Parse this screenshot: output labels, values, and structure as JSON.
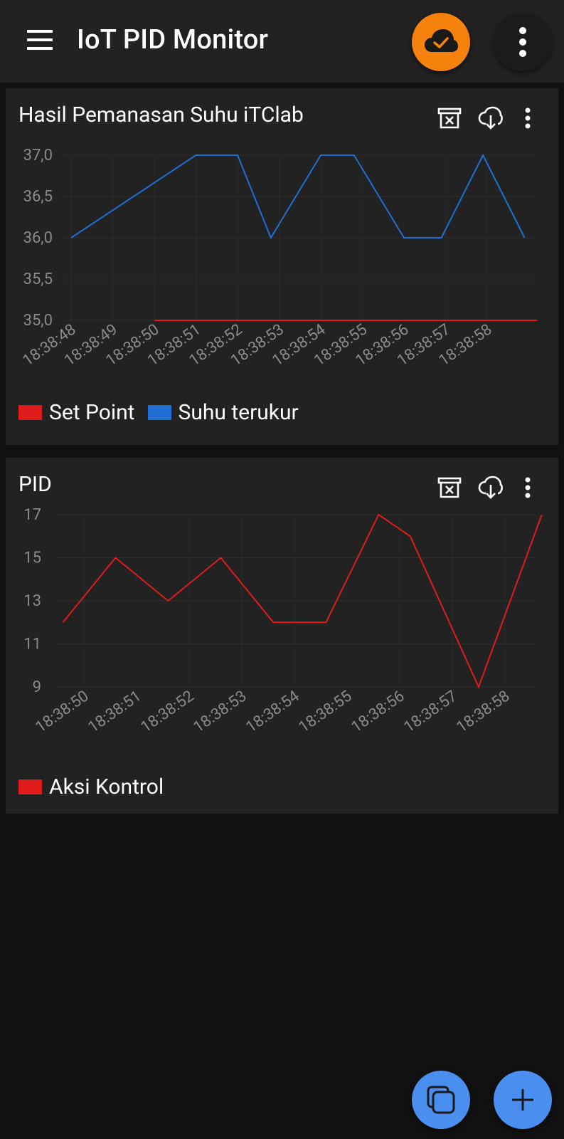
{
  "app": {
    "title": "IoT PID Monitor"
  },
  "colors": {
    "background": "#111111",
    "card": "#222222",
    "accent_orange": "#f5820d",
    "fab_blue": "#4a8ef0",
    "setpoint_red": "#e01b1b",
    "temp_blue": "#1f6fd4"
  },
  "cards": [
    {
      "title": "Hasil Pemanasan Suhu iTClab",
      "legend": [
        {
          "label": "Set Point",
          "color": "#e01b1b"
        },
        {
          "label": "Suhu terukur",
          "color": "#1f6fd4"
        }
      ]
    },
    {
      "title": "PID",
      "legend": [
        {
          "label": "Aksi Kontrol",
          "color": "#e01b1b"
        }
      ]
    }
  ],
  "chart_data": [
    {
      "type": "line",
      "title": "Hasil Pemanasan Suhu iTClab",
      "ylim": [
        35.0,
        37.0
      ],
      "yticks": [
        "37,0",
        "36,5",
        "36,0",
        "35,5",
        "35,0"
      ],
      "categories": [
        "18:38:48",
        "18:38:49",
        "18:38:50",
        "18:38:51",
        "18:38:52",
        "18:38:53",
        "18:38:54",
        "18:38:55",
        "18:38:56",
        "18:38:57",
        "18:38:58"
      ],
      "series": [
        {
          "name": "Suhu terukur",
          "color": "#1f6fd4",
          "points": [
            [
              0,
              36.0
            ],
            [
              3,
              37.0
            ],
            [
              4,
              37.0
            ],
            [
              4.8,
              36.0
            ],
            [
              6,
              37.0
            ],
            [
              6.8,
              37.0
            ],
            [
              8,
              36.0
            ],
            [
              8.9,
              36.0
            ],
            [
              9.9,
              37.0
            ],
            [
              10.9,
              36.0
            ]
          ]
        },
        {
          "name": "Set Point",
          "color": "#e01b1b",
          "points": [
            [
              2,
              35.0
            ],
            [
              11.2,
              35.0
            ]
          ]
        }
      ],
      "grid": true,
      "legend": "bottom-left"
    },
    {
      "type": "line",
      "title": "PID",
      "ylim": [
        9,
        17
      ],
      "yticks": [
        "17",
        "15",
        "13",
        "11",
        "9"
      ],
      "categories": [
        "18:38:50",
        "18:38:51",
        "18:38:52",
        "18:38:53",
        "18:38:54",
        "18:38:55",
        "18:38:56",
        "18:38:57",
        "18:38:58"
      ],
      "series": [
        {
          "name": "Aksi Kontrol",
          "color": "#e01b1b",
          "points": [
            [
              -0.4,
              12
            ],
            [
              0.6,
              15
            ],
            [
              1.6,
              13
            ],
            [
              2.6,
              15
            ],
            [
              3.6,
              12
            ],
            [
              4.6,
              12
            ],
            [
              5.6,
              17
            ],
            [
              6.2,
              16
            ],
            [
              7.5,
              9
            ],
            [
              8.7,
              17
            ]
          ]
        }
      ],
      "grid": true,
      "legend": "bottom-left"
    }
  ]
}
